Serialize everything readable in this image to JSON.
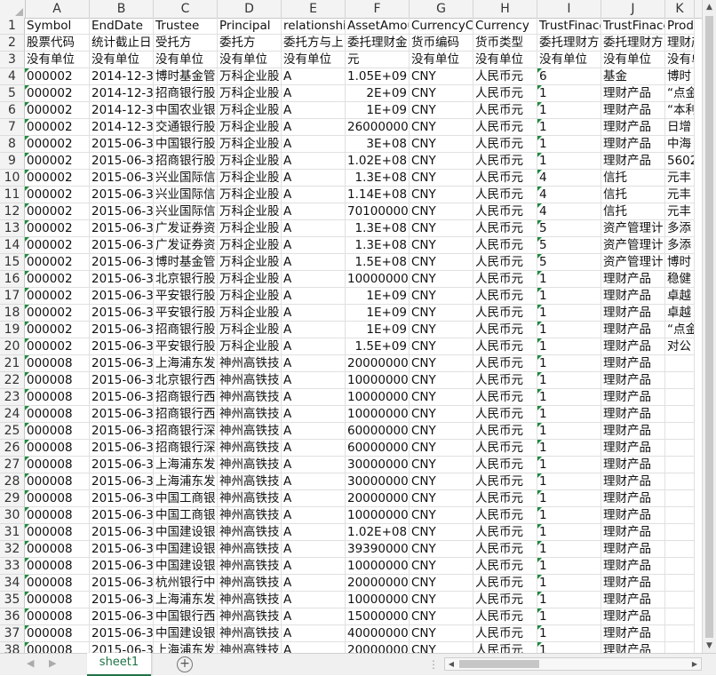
{
  "columns": [
    {
      "letter": "A",
      "w": 73
    },
    {
      "letter": "B",
      "w": 72
    },
    {
      "letter": "C",
      "w": 72
    },
    {
      "letter": "D",
      "w": 72
    },
    {
      "letter": "E",
      "w": 72
    },
    {
      "letter": "F",
      "w": 72
    },
    {
      "letter": "G",
      "w": 72
    },
    {
      "letter": "H",
      "w": 72
    },
    {
      "letter": "I",
      "w": 72
    },
    {
      "letter": "J",
      "w": 72
    },
    {
      "letter": "K",
      "w": 33
    }
  ],
  "rows": [
    [
      "Symbol",
      "EndDate",
      "Trustee",
      "Principal",
      "relationship",
      "AssetAmou",
      "CurrencyCo",
      "Currency",
      "TrustFinace",
      "TrustFinace",
      "Produ"
    ],
    [
      "股票代码",
      "统计截止日",
      "受托方",
      "委托方",
      "委托方与上",
      "委托理财金",
      "货币编码",
      "货币类型",
      "委托理财方",
      "委托理财方",
      "理财产"
    ],
    [
      "没有单位",
      "没有单位",
      "没有单位",
      "没有单位",
      "没有单位",
      "元",
      "没有单位",
      "没有单位",
      "没有单位",
      "没有单位",
      "没有单"
    ],
    [
      "000002",
      "2014-12-3",
      "博时基金管",
      "万科企业股",
      "A",
      "1.05E+09",
      "CNY",
      "人民币元",
      "6",
      "基金",
      "博时"
    ],
    [
      "000002",
      "2014-12-3",
      "招商银行股",
      "万科企业股",
      "A",
      "2E+09",
      "CNY",
      "人民币元",
      "1",
      "理财产品",
      "“点金"
    ],
    [
      "000002",
      "2014-12-3",
      "中国农业银",
      "万科企业股",
      "A",
      "1E+09",
      "CNY",
      "人民币元",
      "1",
      "理财产品",
      "“本利"
    ],
    [
      "000002",
      "2014-12-3",
      "交通银行股",
      "万科企业股",
      "A",
      "26000000",
      "CNY",
      "人民币元",
      "1",
      "理财产品",
      "日增"
    ],
    [
      "000002",
      "2015-06-3",
      "中国银行股",
      "万科企业股",
      "A",
      "3E+08",
      "CNY",
      "人民币元",
      "1",
      "理财产品",
      "中海"
    ],
    [
      "000002",
      "2015-06-3",
      "招商银行股",
      "万科企业股",
      "A",
      "1.02E+08",
      "CNY",
      "人民币元",
      "1",
      "理财产品",
      "5602"
    ],
    [
      "000002",
      "2015-06-3",
      "兴业国际信",
      "万科企业股",
      "A",
      "1.3E+08",
      "CNY",
      "人民币元",
      "4",
      "信托",
      "元丰"
    ],
    [
      "000002",
      "2015-06-3",
      "兴业国际信",
      "万科企业股",
      "A",
      "1.14E+08",
      "CNY",
      "人民币元",
      "4",
      "信托",
      "元丰"
    ],
    [
      "000002",
      "2015-06-3",
      "兴业国际信",
      "万科企业股",
      "A",
      "70100000",
      "CNY",
      "人民币元",
      "4",
      "信托",
      "元丰"
    ],
    [
      "000002",
      "2015-06-3",
      "广发证券资",
      "万科企业股",
      "A",
      "1.3E+08",
      "CNY",
      "人民币元",
      "5",
      "资产管理计",
      "多添"
    ],
    [
      "000002",
      "2015-06-3",
      "广发证券资",
      "万科企业股",
      "A",
      "1.3E+08",
      "CNY",
      "人民币元",
      "5",
      "资产管理计",
      "多添"
    ],
    [
      "000002",
      "2015-06-3",
      "博时基金管",
      "万科企业股",
      "A",
      "1.5E+08",
      "CNY",
      "人民币元",
      "5",
      "资产管理计",
      "博时"
    ],
    [
      "000002",
      "2015-06-3",
      "北京银行股",
      "万科企业股",
      "A",
      "10000000",
      "CNY",
      "人民币元",
      "1",
      "理财产品",
      "稳健"
    ],
    [
      "000002",
      "2015-06-3",
      "平安银行股",
      "万科企业股",
      "A",
      "1E+09",
      "CNY",
      "人民币元",
      "1",
      "理财产品",
      "卓越"
    ],
    [
      "000002",
      "2015-06-3",
      "平安银行股",
      "万科企业股",
      "A",
      "1E+09",
      "CNY",
      "人民币元",
      "1",
      "理财产品",
      "卓越"
    ],
    [
      "000002",
      "2015-06-3",
      "招商银行股",
      "万科企业股",
      "A",
      "1E+09",
      "CNY",
      "人民币元",
      "1",
      "理财产品",
      "“点金"
    ],
    [
      "000002",
      "2015-06-3",
      "平安银行股",
      "万科企业股",
      "A",
      "1.5E+09",
      "CNY",
      "人民币元",
      "1",
      "理财产品",
      "对公"
    ],
    [
      "000008",
      "2015-06-3",
      "上海浦东发",
      "神州高铁技",
      "A",
      "20000000",
      "CNY",
      "人民币元",
      "1",
      "理财产品",
      ""
    ],
    [
      "000008",
      "2015-06-3",
      "北京银行西",
      "神州高铁技",
      "A",
      "10000000",
      "CNY",
      "人民币元",
      "1",
      "理财产品",
      ""
    ],
    [
      "000008",
      "2015-06-3",
      "招商银行西",
      "神州高铁技",
      "A",
      "10000000",
      "CNY",
      "人民币元",
      "1",
      "理财产品",
      ""
    ],
    [
      "000008",
      "2015-06-3",
      "招商银行西",
      "神州高铁技",
      "A",
      "10000000",
      "CNY",
      "人民币元",
      "1",
      "理财产品",
      ""
    ],
    [
      "000008",
      "2015-06-3",
      "招商银行深",
      "神州高铁技",
      "A",
      "60000000",
      "CNY",
      "人民币元",
      "1",
      "理财产品",
      ""
    ],
    [
      "000008",
      "2015-06-3",
      "招商银行深",
      "神州高铁技",
      "A",
      "60000000",
      "CNY",
      "人民币元",
      "1",
      "理财产品",
      ""
    ],
    [
      "000008",
      "2015-06-3",
      "上海浦东发",
      "神州高铁技",
      "A",
      "30000000",
      "CNY",
      "人民币元",
      "1",
      "理财产品",
      ""
    ],
    [
      "000008",
      "2015-06-3",
      "上海浦东发",
      "神州高铁技",
      "A",
      "30000000",
      "CNY",
      "人民币元",
      "1",
      "理财产品",
      ""
    ],
    [
      "000008",
      "2015-06-3",
      "中国工商银",
      "神州高铁技",
      "A",
      "20000000",
      "CNY",
      "人民币元",
      "1",
      "理财产品",
      ""
    ],
    [
      "000008",
      "2015-06-3",
      "中国工商银",
      "神州高铁技",
      "A",
      "10000000",
      "CNY",
      "人民币元",
      "1",
      "理财产品",
      ""
    ],
    [
      "000008",
      "2015-06-3",
      "中国建设银",
      "神州高铁技",
      "A",
      "1.02E+08",
      "CNY",
      "人民币元",
      "1",
      "理财产品",
      ""
    ],
    [
      "000008",
      "2015-06-3",
      "中国建设银",
      "神州高铁技",
      "A",
      "39390000",
      "CNY",
      "人民币元",
      "1",
      "理财产品",
      ""
    ],
    [
      "000008",
      "2015-06-3",
      "中国建设银",
      "神州高铁技",
      "A",
      "10000000",
      "CNY",
      "人民币元",
      "1",
      "理财产品",
      ""
    ],
    [
      "000008",
      "2015-06-3",
      "杭州银行中",
      "神州高铁技",
      "A",
      "20000000",
      "CNY",
      "人民币元",
      "1",
      "理财产品",
      ""
    ],
    [
      "000008",
      "2015-06-3",
      "上海浦东发",
      "神州高铁技",
      "A",
      "10000000",
      "CNY",
      "人民币元",
      "1",
      "理财产品",
      ""
    ],
    [
      "000008",
      "2015-06-3",
      "中国银行西",
      "神州高铁技",
      "A",
      "15000000",
      "CNY",
      "人民币元",
      "1",
      "理财产品",
      ""
    ],
    [
      "000008",
      "2015-06-3",
      "中国建设银",
      "神州高铁技",
      "A",
      "40000000",
      "CNY",
      "人民币元",
      "1",
      "理财产品",
      ""
    ],
    [
      "000008",
      "2015-06-3",
      "上海浦东发",
      "神州高铁技",
      "A",
      "20000000",
      "CNY",
      "人民币元",
      "1",
      "理财产品",
      ""
    ]
  ],
  "sheet_tab": "sheet1",
  "add_sheet_symbol": "+",
  "hscroll_dots": "⋮"
}
